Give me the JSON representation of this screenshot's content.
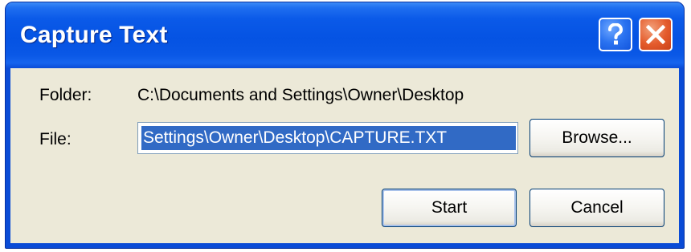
{
  "window": {
    "title": "Capture Text",
    "help_icon": "question-mark-icon",
    "close_icon": "close-x-icon"
  },
  "form": {
    "folder_label": "Folder:",
    "folder_path": "C:\\Documents and Settings\\Owner\\Desktop",
    "file_label": "File:",
    "file_value": "Settings\\Owner\\Desktop\\CAPTURE.TXT",
    "browse_label": "Browse..."
  },
  "buttons": {
    "start_label": "Start",
    "cancel_label": "Cancel"
  },
  "colors": {
    "titlebar": "#0553e3",
    "close": "#e45b2c",
    "dialog_face": "#ece9d8",
    "selection": "#316ac5"
  }
}
